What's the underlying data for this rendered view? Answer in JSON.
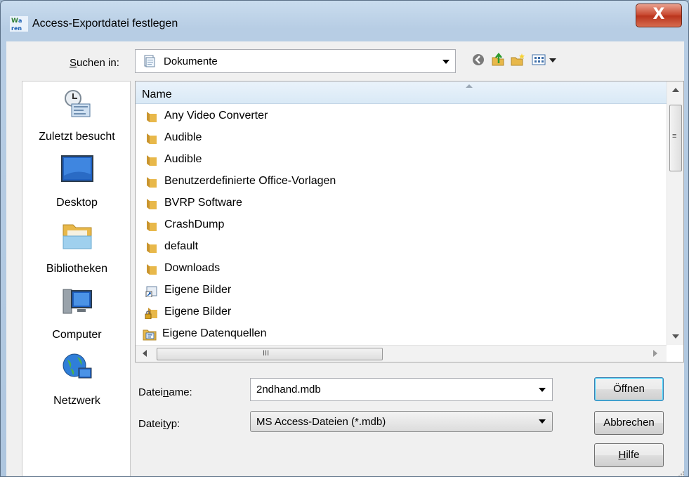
{
  "window": {
    "title": "Access-Exportdatei festlegen",
    "close_label": "X"
  },
  "lookin": {
    "label": "Suchen in:",
    "label_accesskey_char": "S",
    "label_rest": "uchen in:",
    "value": "Dokumente"
  },
  "toolbar": {
    "back": "back-icon",
    "up": "up-folder-icon",
    "new_folder": "new-folder-icon",
    "views": "view-menu-icon"
  },
  "places": [
    {
      "label": "Zuletzt besucht",
      "icon": "recent-places-icon"
    },
    {
      "label": "Desktop",
      "icon": "desktop-icon"
    },
    {
      "label": "Bibliotheken",
      "icon": "libraries-icon"
    },
    {
      "label": "Computer",
      "icon": "computer-icon"
    },
    {
      "label": "Netzwerk",
      "icon": "network-icon"
    }
  ],
  "filelist": {
    "column_name": "Name",
    "items": [
      {
        "name": "Any Video Converter",
        "icon": "folder"
      },
      {
        "name": "Audible",
        "icon": "folder"
      },
      {
        "name": "Audible",
        "icon": "folder"
      },
      {
        "name": "Benutzerdefinierte Office-Vorlagen",
        "icon": "folder"
      },
      {
        "name": "BVRP Software",
        "icon": "folder"
      },
      {
        "name": "CrashDump",
        "icon": "folder"
      },
      {
        "name": "default",
        "icon": "folder"
      },
      {
        "name": "Downloads",
        "icon": "folder"
      },
      {
        "name": "Eigene Bilder",
        "icon": "shortcut-folder"
      },
      {
        "name": "Eigene Bilder",
        "icon": "locked-folder"
      },
      {
        "name": "Eigene Datenquellen",
        "icon": "datasource-folder"
      }
    ],
    "hscroll_grip": "III",
    "vscroll_grip": "≡"
  },
  "filename": {
    "label_pre": "Datei",
    "label_key": "n",
    "label_post": "ame:",
    "value": "2ndhand.mdb"
  },
  "filetype": {
    "label_pre": "Datei",
    "label_key": "t",
    "label_post": "yp:",
    "value": "MS Access-Dateien (*.mdb)"
  },
  "buttons": {
    "open": "Öffnen",
    "cancel": "Abbrechen",
    "help_key": "H",
    "help_rest": "ilfe"
  },
  "colors": {
    "folder": "#e8b84a",
    "header_bg": "#d9e9f6",
    "close": "#c7442b"
  }
}
